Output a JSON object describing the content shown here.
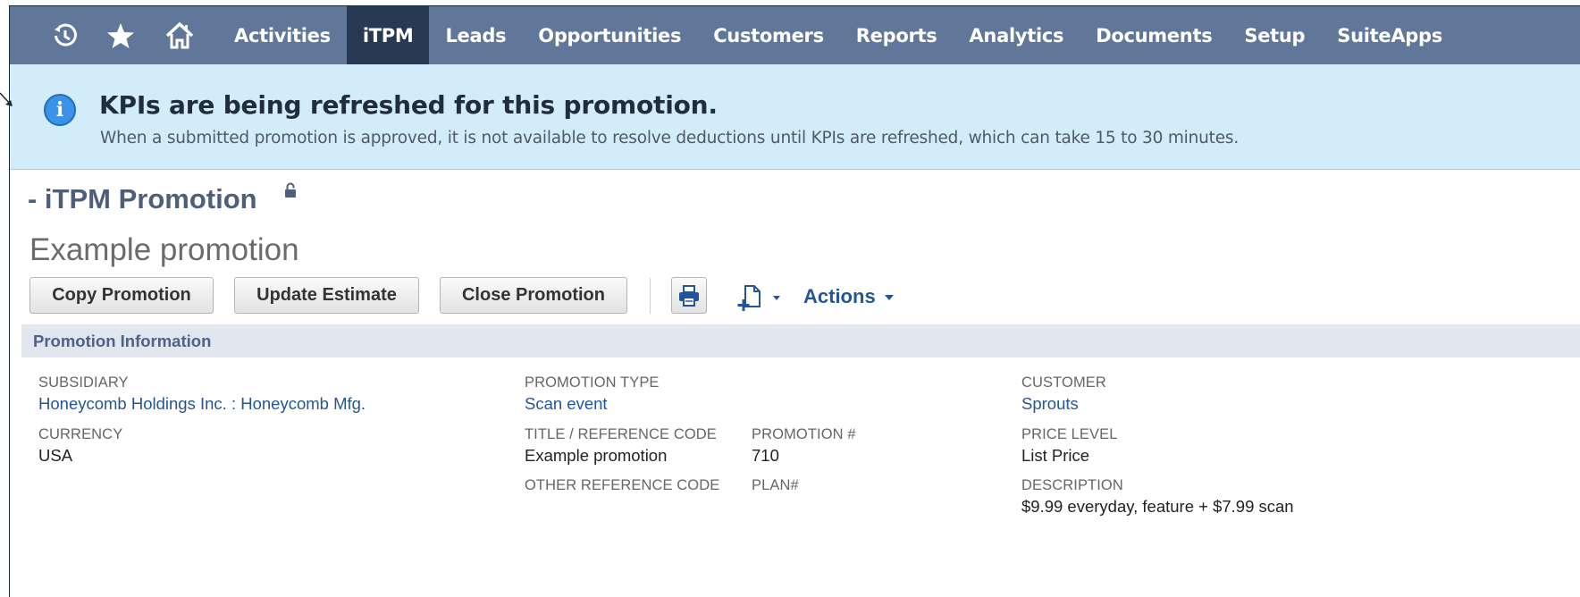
{
  "nav": {
    "icons": [
      "recent-records-icon",
      "star-icon",
      "home-icon"
    ],
    "items": [
      {
        "label": "Activities",
        "active": false
      },
      {
        "label": "iTPM",
        "active": true
      },
      {
        "label": "Leads",
        "active": false
      },
      {
        "label": "Opportunities",
        "active": false
      },
      {
        "label": "Customers",
        "active": false
      },
      {
        "label": "Reports",
        "active": false
      },
      {
        "label": "Analytics",
        "active": false
      },
      {
        "label": "Documents",
        "active": false
      },
      {
        "label": "Setup",
        "active": false
      },
      {
        "label": "SuiteApps",
        "active": false
      }
    ]
  },
  "banner": {
    "icon": "info-icon",
    "title": "KPIs are being refreshed for this promotion.",
    "message": "When a submitted promotion is approved, it is not available to resolve deductions until KPIs are refreshed, which can take 15 to 30 minutes."
  },
  "record": {
    "type": "- iTPM Promotion",
    "title": "Example promotion"
  },
  "toolbar": {
    "copy": "Copy Promotion",
    "update": "Update Estimate",
    "close": "Close Promotion",
    "actions": "Actions"
  },
  "section": {
    "title": "Promotion Information"
  },
  "fields": {
    "subsidiary": {
      "label": "SUBSIDIARY",
      "value": "Honeycomb Holdings Inc. : Honeycomb Mfg."
    },
    "currency": {
      "label": "CURRENCY",
      "value": "USA"
    },
    "promotion_type": {
      "label": "PROMOTION TYPE",
      "value": "Scan event"
    },
    "title_ref": {
      "label": "TITLE / REFERENCE CODE",
      "value": "Example promotion"
    },
    "promotion_num": {
      "label": "PROMOTION #",
      "value": "710"
    },
    "other_ref": {
      "label": "OTHER REFERENCE CODE",
      "value": ""
    },
    "plan": {
      "label": "PLAN#",
      "value": ""
    },
    "customer": {
      "label": "CUSTOMER",
      "value": "Sprouts"
    },
    "price_level": {
      "label": "PRICE LEVEL",
      "value": "List Price"
    },
    "description": {
      "label": "DESCRIPTION",
      "value": "$9.99 everyday, feature + $7.99 scan"
    }
  },
  "colors": {
    "nav_bg": "#607799",
    "nav_active": "#273953",
    "banner_bg": "#d2ecf9",
    "link": "#255599"
  }
}
